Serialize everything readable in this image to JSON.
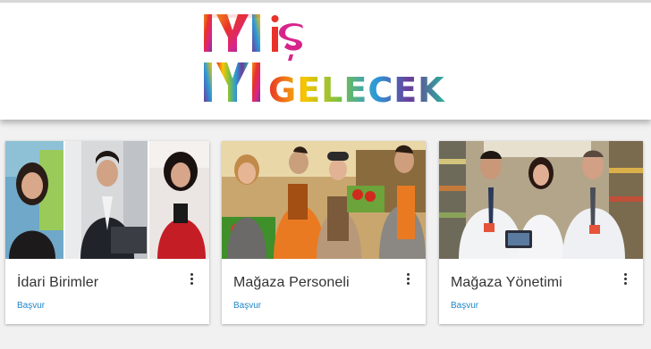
{
  "brand": {
    "logo_line1": "IYI iş",
    "logo_line2": "IYI GELECEK"
  },
  "cards": [
    {
      "title": "İdari Birimler",
      "action": "Başvur"
    },
    {
      "title": "Mağaza Personeli",
      "action": "Başvur"
    },
    {
      "title": "Mağaza Yönetimi",
      "action": "Başvur"
    }
  ],
  "colors": {
    "link": "#1e86c8",
    "logo_palette": [
      "#e8322a",
      "#f28d1b",
      "#f7c600",
      "#7cc144",
      "#2b9bd7",
      "#6a3d9a",
      "#d8248a"
    ]
  }
}
